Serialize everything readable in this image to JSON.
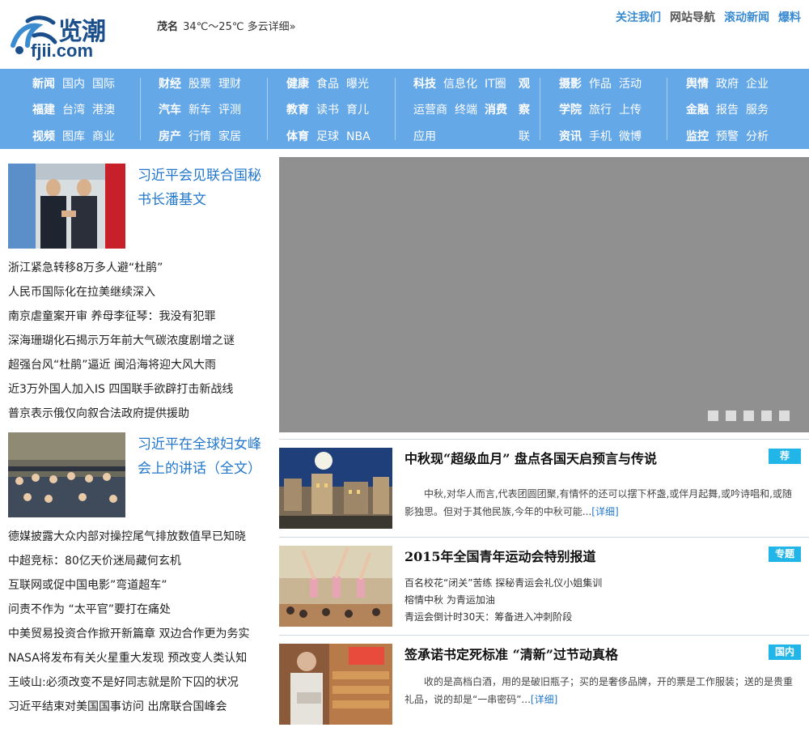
{
  "header": {
    "logo_cn": "览潮",
    "logo_en": "fjii.com",
    "weather": {
      "city": "茂名",
      "temp": "34℃～25℃",
      "desc": "多云",
      "detail": "详细»"
    },
    "links": [
      "关注我们",
      "网站导航",
      "滚动新闻",
      "爆料"
    ]
  },
  "nav": {
    "groups": [
      {
        "rows": [
          [
            "新闻",
            "国内",
            "国际"
          ],
          [
            "福建",
            "台湾",
            "港澳"
          ],
          [
            "视频",
            "图库",
            "商业"
          ]
        ]
      },
      {
        "rows": [
          [
            "财经",
            "股票",
            "理财"
          ],
          [
            "汽车",
            "新车",
            "评测"
          ],
          [
            "房产",
            "行情",
            "家居"
          ]
        ]
      },
      {
        "rows": [
          [
            "健康",
            "食品",
            "曝光"
          ],
          [
            "教育",
            "读书",
            "育儿"
          ],
          [
            "体育",
            "足球",
            "NBA"
          ]
        ]
      },
      {
        "rows": [
          [
            "科技",
            "信息化",
            "IT圈"
          ],
          [
            "运营商",
            "终端",
            "消费"
          ],
          [
            "应用"
          ]
        ],
        "extra": [
          "观",
          "察",
          "联"
        ]
      },
      {
        "rows": [
          [
            "摄影",
            "作品",
            "活动"
          ],
          [
            "学院",
            "旅行",
            "上传"
          ],
          [
            "资讯",
            "手机",
            "微博"
          ]
        ]
      },
      {
        "rows": [
          [
            "舆情",
            "政府",
            "企业"
          ],
          [
            "金融",
            "报告",
            "服务"
          ],
          [
            "监控",
            "预警",
            "分析"
          ]
        ]
      }
    ]
  },
  "left": {
    "feature1": {
      "title": "习近平会见联合国秘书长潘基文"
    },
    "list1": [
      "浙江紧急转移8万多人避“杜鹃”",
      "人民币国际化在拉美继续深入",
      "南京虐童案开审 养母李征琴：我没有犯罪",
      "深海珊瑚化石揭示万年前大气碳浓度剧增之谜",
      "超强台风“杜鹃”逼近 闽沿海将迎大风大雨",
      "近3万外国人加入IS 四国联手欲辟打击新战线",
      "普京表示俄仅向叙合法政府提供援助"
    ],
    "feature2": {
      "title": "习近平在全球妇女峰会上的讲话（全文）"
    },
    "list2": [
      "德媒披露大众内部对操控尾气排放数值早已知晓",
      "中超竞标：80亿天价迷局藏何玄机",
      "互联网或促中国电影”弯道超车”",
      "问责不作为 “太平官”要打在痛处",
      "中美贸易投资合作掀开新篇章 双边合作更为务实",
      "NASA将发布有关火星重大发现 预改变人类认知",
      "王岐山:必须改变不是好同志就是阶下囚的状况",
      "习近平结束对美国国事访问 出席联合国峰会"
    ]
  },
  "slider": {
    "dots": 5
  },
  "stories": [
    {
      "title": "中秋现“超级血月” 盘点各国天启预言与传说",
      "badge": "荐",
      "text": "中秋,对华人而言,代表团圆团聚,有情怀的还可以摆下杯盏,或伴月起舞,或吟诗唱和,或随影独思。但对于其他民族,今年的中秋可能...",
      "more": "[详细]"
    },
    {
      "title": "2015年全国青年运动会特别报道",
      "badge": "专题",
      "links": [
        "百名校花“闭关”苦练 探秘青运会礼仪小姐集训",
        "榕情中秋 为青运加油",
        "青运会倒计时30天：筹备进入冲刺阶段"
      ]
    },
    {
      "title": "签承诺书定死标准 “清新”过节动真格",
      "badge": "国内",
      "text": "收的是高档白酒，用的是破旧瓶子；买的是奢侈品牌，开的票是工作服装；送的是贵重礼品，说的却是“一串密码”...",
      "more": "[详细]"
    }
  ]
}
